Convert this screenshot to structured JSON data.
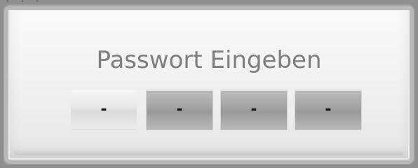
{
  "dialog": {
    "title": "Passwort Eingeben",
    "pin_slots": [
      "-",
      "-",
      "-",
      "-"
    ],
    "active_slot": 1
  }
}
